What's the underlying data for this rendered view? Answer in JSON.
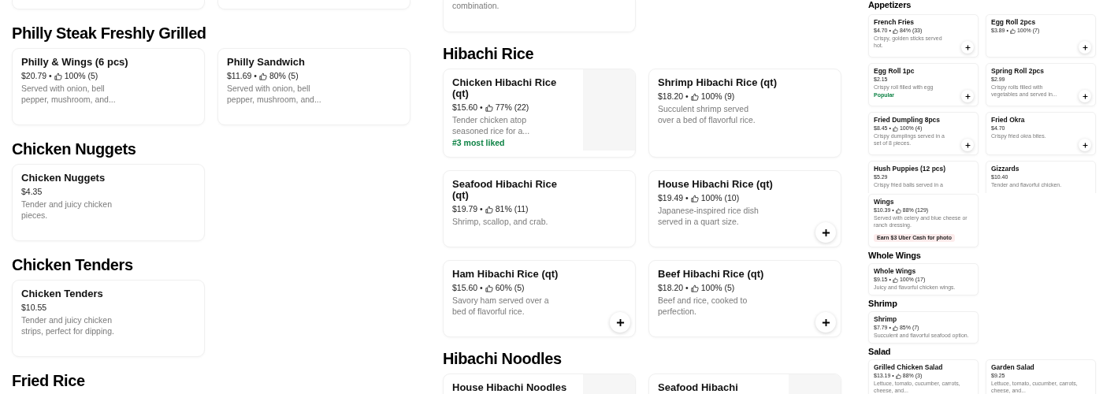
{
  "panels": [
    {
      "sections": [
        {
          "items": [
            {
              "cut": true
            },
            {
              "cut": true
            }
          ]
        },
        {
          "title": "Philly Steak Freshly Grilled",
          "items": [
            {
              "name": "Philly & Wings (6 pcs)",
              "price": "$20.79 •",
              "rating": "100% (5)",
              "description": "Served with onion, bell pepper, mushroom, and..."
            },
            {
              "name": "Philly Sandwich",
              "price": "$11.69 •",
              "rating": "80% (5)",
              "description": "Served with onion, bell pepper, mushroom, and..."
            }
          ]
        },
        {
          "title": "Chicken Nuggets",
          "items": [
            {
              "name": "Chicken Nuggets",
              "price": "$4.35",
              "description": "Tender and juicy chicken pieces."
            }
          ]
        },
        {
          "title": "Chicken Tenders",
          "items": [
            {
              "name": "Chicken Tenders",
              "price": "$10.55",
              "description": "Tender and juicy chicken strips, perfect for dipping."
            }
          ]
        },
        {
          "title": "Fried Rice"
        }
      ]
    },
    {
      "sections": [
        {
          "items": [
            {
              "cut": true,
              "description": "combination."
            }
          ]
        },
        {
          "title": "Hibachi Rice",
          "items": [
            {
              "name": "Chicken Hibachi Rice (qt)",
              "price": "$15.60 •",
              "rating": "77% (22)",
              "description": "Tender chicken atop seasoned rice for a...",
              "tag": {
                "kind": "highlight",
                "text": "#3 most liked"
              },
              "image": true
            },
            {
              "name": "Shrimp Hibachi Rice (qt)",
              "price": "$18.20 •",
              "rating": "100% (9)",
              "description": "Succulent shrimp served over a bed of flavorful rice."
            },
            {
              "name": "Seafood Hibachi Rice (qt)",
              "price": "$19.79 •",
              "rating": "81% (11)",
              "description": "Shrimp, scallop, and crab."
            },
            {
              "name": "House Hibachi Rice (qt)",
              "price": "$19.49 •",
              "rating": "100% (10)",
              "description": "Japanese-inspired rice dish served in a quart size.",
              "add_button": true
            },
            {
              "name": "Ham Hibachi Rice (qt)",
              "price": "$15.60 •",
              "rating": "60% (5)",
              "description": "Savory ham served over a bed of flavorful rice.",
              "add_button": true
            },
            {
              "name": "Beef Hibachi Rice (qt)",
              "price": "$18.20 •",
              "rating": "100% (5)",
              "description": "Beef and rice, cooked to perfection.",
              "add_button": true
            }
          ]
        },
        {
          "title": "Hibachi Noodles",
          "items": [
            {
              "name": "House Hibachi Noodles",
              "image": true
            },
            {
              "name": "Seafood Hibachi",
              "image": true
            }
          ]
        }
      ]
    },
    {
      "sections": [
        {
          "title": "Appetizers",
          "items": [
            {
              "name": "French Fries",
              "price": "$4.70 •",
              "rating": "84% (33)",
              "description": "Crispy, golden sticks served hot.",
              "add_button": true
            },
            {
              "name": "Egg Roll 2pcs",
              "price": "$3.89 •",
              "rating": "100% (7)",
              "add_button": true
            },
            {
              "name": "Egg Roll 1pc",
              "price": "$2.15",
              "description": "Crispy roll filled with egg",
              "tag": {
                "kind": "highlight",
                "text": "Popular"
              },
              "add_button": true
            },
            {
              "name": "Spring Roll 2pcs",
              "price": "$2.99",
              "description": "Crispy rolls filled with vegetables and served in...",
              "add_button": true
            },
            {
              "name": "Fried Dumpling 8pcs",
              "price": "$8.45 •",
              "rating": "100% (4)",
              "description": "Crispy dumplings served in a set of 8 pieces.",
              "add_button": true
            },
            {
              "name": "Fried Okra",
              "price": "$4.70",
              "description": "Crispy fried okra bites.",
              "add_button": true
            },
            {
              "name": "Hush Puppies (12 pcs)",
              "price": "$5.29",
              "description": "Crispy fried balls served in a"
            },
            {
              "name": "Gizzards",
              "price": "$10.40",
              "description": "Tender and flavorful chicken."
            }
          ]
        }
      ]
    },
    {
      "sections": [
        {
          "items": [
            {
              "name": "Wings",
              "price": "$10.39 •",
              "rating": "88% (129)",
              "description": "Served with celery and blue cheese or ranch dressing.",
              "tag": {
                "kind": "promo",
                "text": "Earn $3 Uber Cash for photo"
              }
            }
          ]
        },
        {
          "title": "Whole Wings",
          "items": [
            {
              "name": "Whole Wings",
              "price": "$9.15 •",
              "rating": "100% (17)",
              "description": "Juicy and flavorful chicken wings."
            }
          ]
        },
        {
          "title": "Shrimp",
          "items": [
            {
              "name": "Shrimp",
              "price": "$7.79 •",
              "rating": "85% (7)",
              "description": "Succulent and flavorful seafood option."
            }
          ]
        },
        {
          "title": "Salad",
          "items": [
            {
              "name": "Grilled Chicken Salad",
              "price": "$13.19 •",
              "rating": "88% (3)",
              "description": "Lettuce, tomato, cucumber, carrots, cheese, and..."
            },
            {
              "name": "Garden Salad",
              "price": "$9.25",
              "description": "Lettuce, tomato, cucumber, carrots, cheese, and..."
            }
          ]
        }
      ]
    }
  ]
}
